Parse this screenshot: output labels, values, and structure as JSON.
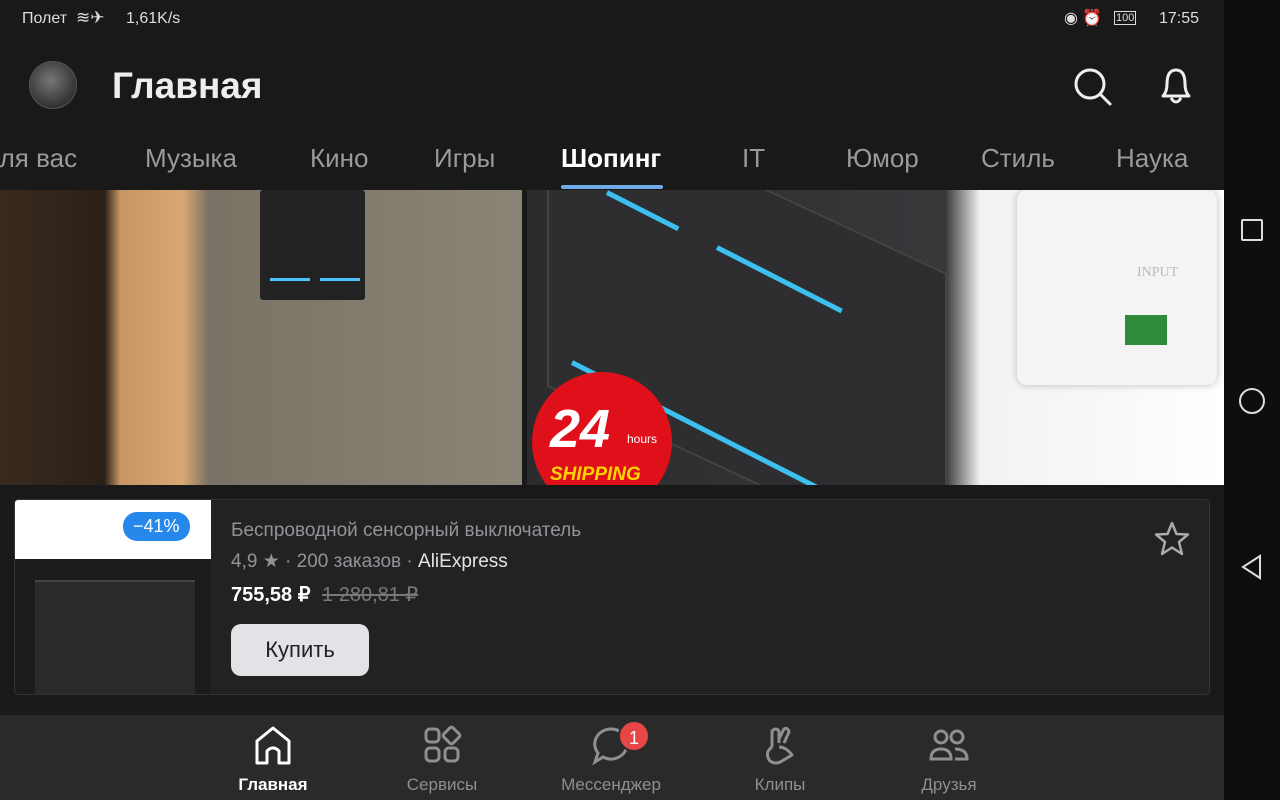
{
  "status": {
    "left": "Полет",
    "speed": "1,61K/s",
    "battery": "100",
    "time": "17:55"
  },
  "header": {
    "title": "Главная",
    "icons": [
      "search-icon",
      "bell-icon"
    ]
  },
  "tabs": [
    {
      "label": "Для вас"
    },
    {
      "label": "Музыка"
    },
    {
      "label": "Кино"
    },
    {
      "label": "Игры"
    },
    {
      "label": "Шопинг",
      "active": true
    },
    {
      "label": "IT"
    },
    {
      "label": "Юмор"
    },
    {
      "label": "Стиль"
    },
    {
      "label": "Наука"
    }
  ],
  "accent": "#71aaeb",
  "banner": {
    "shipping_big": "24",
    "shipping_small": "hours",
    "shipping_label": "SHIPPING",
    "input_label": "INPUT"
  },
  "product": {
    "discount": "−41%",
    "title": "Беспроводной сенсорный выключатель",
    "rating": "4,9",
    "orders": "· 200 заказов ·",
    "store": "AliExpress",
    "price": "755,58 ₽",
    "old_price": "1 280,81 ₽",
    "buy_label": "Купить"
  },
  "bottom_nav": [
    {
      "label": "Главная",
      "icon": "home-icon",
      "active": true
    },
    {
      "label": "Сервисы",
      "icon": "services-icon"
    },
    {
      "label": "Мессенджер",
      "icon": "message-icon",
      "badge": "1"
    },
    {
      "label": "Клипы",
      "icon": "clips-icon"
    },
    {
      "label": "Друзья",
      "icon": "friends-icon"
    }
  ]
}
